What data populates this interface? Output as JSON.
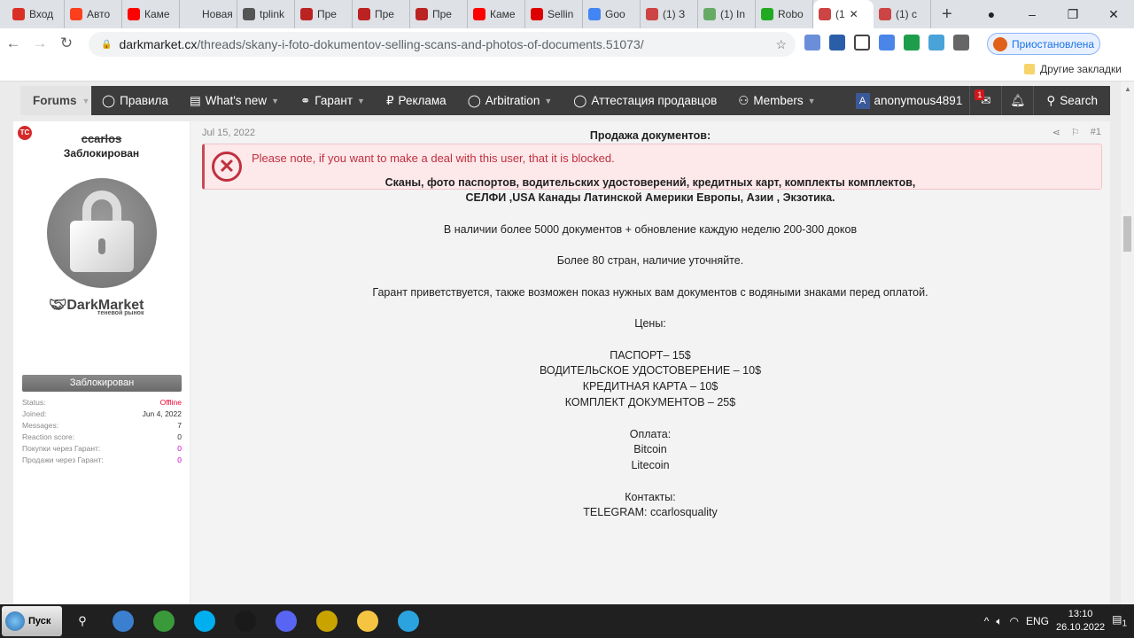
{
  "browser": {
    "tabs": [
      {
        "label": "Вход",
        "color": "#d93025"
      },
      {
        "label": "Авто",
        "color": "#fc3f1d"
      },
      {
        "label": "Каме",
        "color": "#ff0000"
      },
      {
        "label": "Новая вк",
        "color": "#dee1e6"
      },
      {
        "label": "tplink",
        "color": "#555"
      },
      {
        "label": "Пре",
        "color": "#b22"
      },
      {
        "label": "Пре",
        "color": "#b22"
      },
      {
        "label": "Пре",
        "color": "#b22"
      },
      {
        "label": "Каме",
        "color": "#ff0000"
      },
      {
        "label": "Sellin",
        "color": "#d00"
      },
      {
        "label": "Goo",
        "color": "#4285f4"
      },
      {
        "label": "(1) З",
        "color": "#c44"
      },
      {
        "label": "(1) In",
        "color": "#6a6"
      },
      {
        "label": "Robo",
        "color": "#2a2"
      },
      {
        "label": "(1",
        "color": "#c44",
        "active": true
      },
      {
        "label": "(1) c",
        "color": "#c44"
      }
    ],
    "url_host": "darkmarket.cx",
    "url_path": "/threads/skany-i-foto-dokumentov-selling-scans-and-photos-of-documents.51073/",
    "profile_label": "Приостановлена",
    "other_bookmarks": "Другие закладки"
  },
  "nav": {
    "forums": "Forums",
    "items": [
      {
        "label": "Правила",
        "icon": "comment-icon"
      },
      {
        "label": "What's new",
        "icon": "newspaper-icon",
        "caret": true
      },
      {
        "label": "Гарант",
        "icon": "handshake-icon",
        "caret": true
      },
      {
        "label": "Реклама",
        "icon": "ruble-icon"
      },
      {
        "label": "Arbitration",
        "icon": "comment-icon",
        "caret": true
      },
      {
        "label": "Аттестация продавцов",
        "icon": "comment-icon"
      },
      {
        "label": "Members",
        "icon": "users-icon",
        "caret": true
      }
    ],
    "user_initial": "A",
    "username": "anonymous4891",
    "inbox_count": "1",
    "search": "Search"
  },
  "user": {
    "badge": "TC",
    "name": "ccarlos",
    "title": "Заблокирован",
    "logo": "DarkMarket",
    "logo_sub": "теневой рынок",
    "banner": "Заблокирован",
    "stats": [
      {
        "k": "Status:",
        "v": "Offline",
        "c": "#e03"
      },
      {
        "k": "Joined:",
        "v": "Jun 4, 2022",
        "c": "#333"
      },
      {
        "k": "Messages:",
        "v": "7",
        "c": "#333"
      },
      {
        "k": "Reaction score:",
        "v": "0",
        "c": "#333"
      },
      {
        "k": "Покупки через Гарант:",
        "v": "0",
        "c": "#c0c"
      },
      {
        "k": "Продажи через Гарант:",
        "v": "0",
        "c": "#c0c"
      }
    ]
  },
  "post": {
    "date": "Jul 15, 2022",
    "number": "#1",
    "alert": "Please note, if you want to make a deal with this user, that it is blocked.",
    "lines": [
      {
        "t": "Продажа документов:",
        "b": true
      },
      {
        "t": "Сканы, фото паспортов, водительских удостоверений, кредитных карт, комплекты комплектов,",
        "b": true
      },
      {
        "t": "СЕЛФИ ,USA Канады Латинской Америки Европы, Азии , Экзотика.",
        "b": true
      },
      {
        "t": "В наличии более 5000 документов + обновление каждую неделю 200-300 доков"
      },
      {
        "t": "Более 80 стран, наличие уточняйте."
      },
      {
        "t": "Гарант приветствуется, также возможен показ нужных вам документов с водяными знаками перед оплатой."
      },
      {
        "t": "Цены:"
      },
      {
        "t": "ПАСПОРТ– 15$"
      },
      {
        "t": "ВОДИТЕЛЬСКОЕ УДОСТОВЕРЕНИЕ – 10$"
      },
      {
        "t": "КРЕДИТНАЯ КАРТА – 10$"
      },
      {
        "t": "КОМПЛЕКТ ДОКУМЕНТОВ – 25$"
      },
      {
        "t": "Оплата:"
      },
      {
        "t": "Bitcoin"
      },
      {
        "t": "Litecoin"
      },
      {
        "t": "Контакты:"
      },
      {
        "t": "TELEGRAM: ccarlosquality"
      }
    ]
  },
  "taskbar": {
    "start": "Пуск",
    "apps": [
      {
        "name": "browser",
        "color": "#3a7fd0"
      },
      {
        "name": "utorrent",
        "color": "#3a9a3a"
      },
      {
        "name": "skype",
        "color": "#00aff0"
      },
      {
        "name": "icq",
        "color": "#1a1a1a"
      },
      {
        "name": "discord",
        "color": "#5865f2"
      },
      {
        "name": "xmind",
        "color": "#c9a400"
      },
      {
        "name": "explorer",
        "color": "#f5c542"
      },
      {
        "name": "telegram",
        "color": "#2aa3df"
      }
    ],
    "lang": "ENG",
    "time": "13:10",
    "date": "26.10.2022",
    "notif": "1"
  }
}
